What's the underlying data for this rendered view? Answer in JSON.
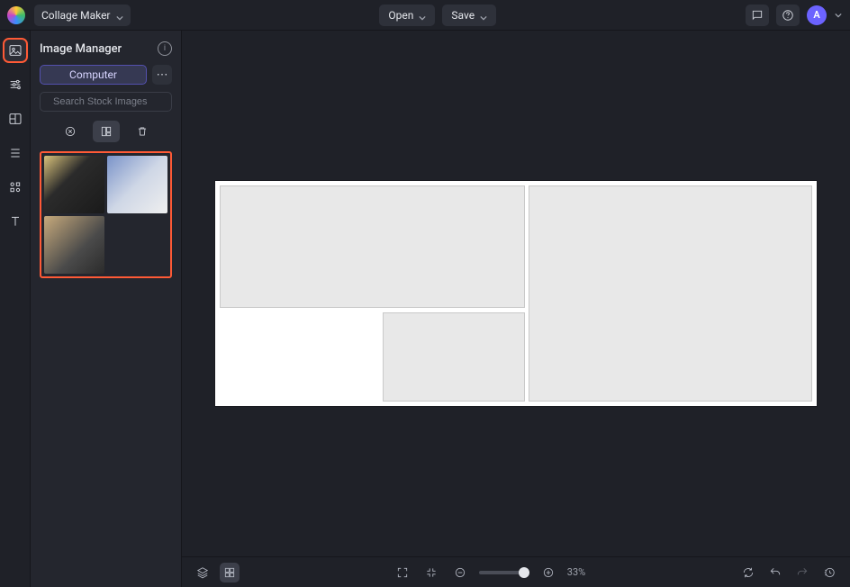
{
  "header": {
    "tool_label": "Collage Maker",
    "open_label": "Open",
    "save_label": "Save",
    "avatar_initial": "A"
  },
  "rail": {
    "items": [
      {
        "name": "image-manager",
        "active": true
      },
      {
        "name": "adjust",
        "active": false
      },
      {
        "name": "layouts",
        "active": false
      },
      {
        "name": "layers",
        "active": false
      },
      {
        "name": "elements",
        "active": false
      },
      {
        "name": "text",
        "active": false
      }
    ]
  },
  "panel": {
    "title": "Image Manager",
    "upload_label": "Computer",
    "search_placeholder": "Search Stock Images",
    "thumbnails": [
      "th1",
      "th2",
      "th3"
    ]
  },
  "canvas": {
    "zoom_percent": "33%"
  }
}
